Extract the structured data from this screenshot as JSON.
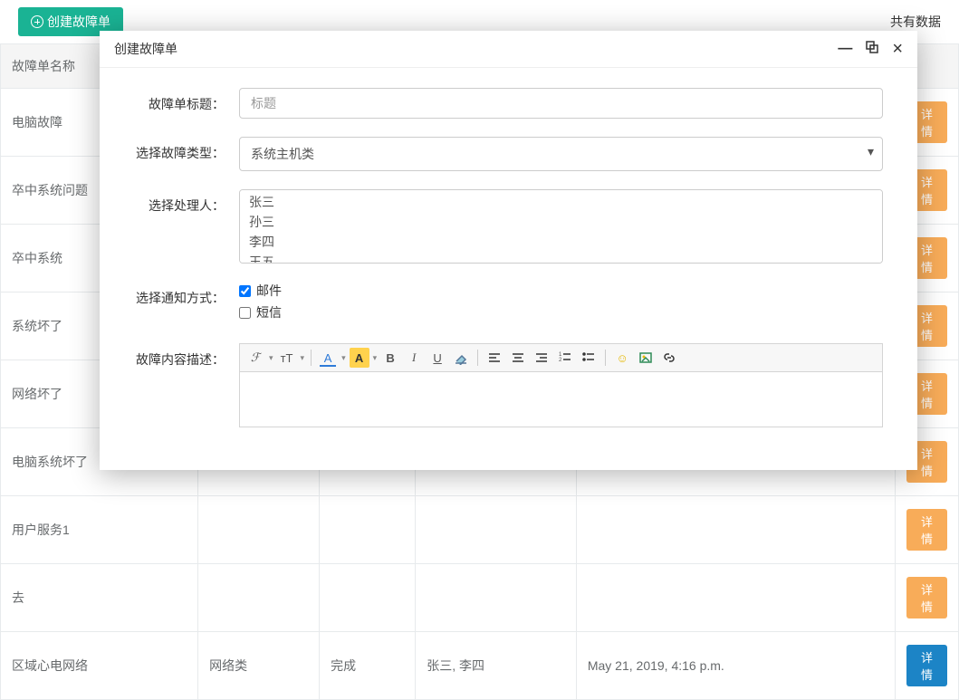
{
  "topbar": {
    "create_label": "创建故障单",
    "summary_label": "共有数据"
  },
  "table": {
    "headers": [
      "故障单名称",
      "",
      "",
      "",
      ""
    ],
    "rows": [
      {
        "name": "电脑故障"
      },
      {
        "name": "卒中系统问题"
      },
      {
        "name": "卒中系统"
      },
      {
        "name": "系统坏了"
      },
      {
        "name": "网络坏了"
      },
      {
        "name": "电脑系统坏了"
      },
      {
        "name": "用户服务1"
      },
      {
        "name": "去"
      }
    ],
    "last_row": {
      "name": "区域心电网络",
      "type": "网络类",
      "status": "完成",
      "assignees": "张三, 李四",
      "time": "May 21, 2019, 4:16 p.m."
    },
    "detail_label": "详情"
  },
  "modal": {
    "title": "创建故障单",
    "labels": {
      "title": "故障单标题：",
      "type": "选择故障类型：",
      "assignee": "选择处理人：",
      "notify": "选择通知方式：",
      "content": "故障内容描述："
    },
    "title_placeholder": "标题",
    "type_value": "系统主机类",
    "assignee_options": [
      "张三",
      "孙三",
      "李四",
      "王五"
    ],
    "notify": {
      "email_label": "邮件",
      "email_checked": true,
      "sms_label": "短信",
      "sms_checked": false
    },
    "editor_icons": {
      "fontfamily": "ℱ",
      "fontsize": "ᴛT",
      "fontcolor": "A",
      "bgcolor": "A",
      "bold": "B",
      "italic": "I",
      "underline": "U",
      "eraser": "⌫",
      "align_left": "≡",
      "align_center": "≡",
      "align_right": "≡",
      "list_ol": "≣",
      "list_ul": "≣",
      "smiley": "☺",
      "image": "▧",
      "link": "⧉"
    }
  }
}
